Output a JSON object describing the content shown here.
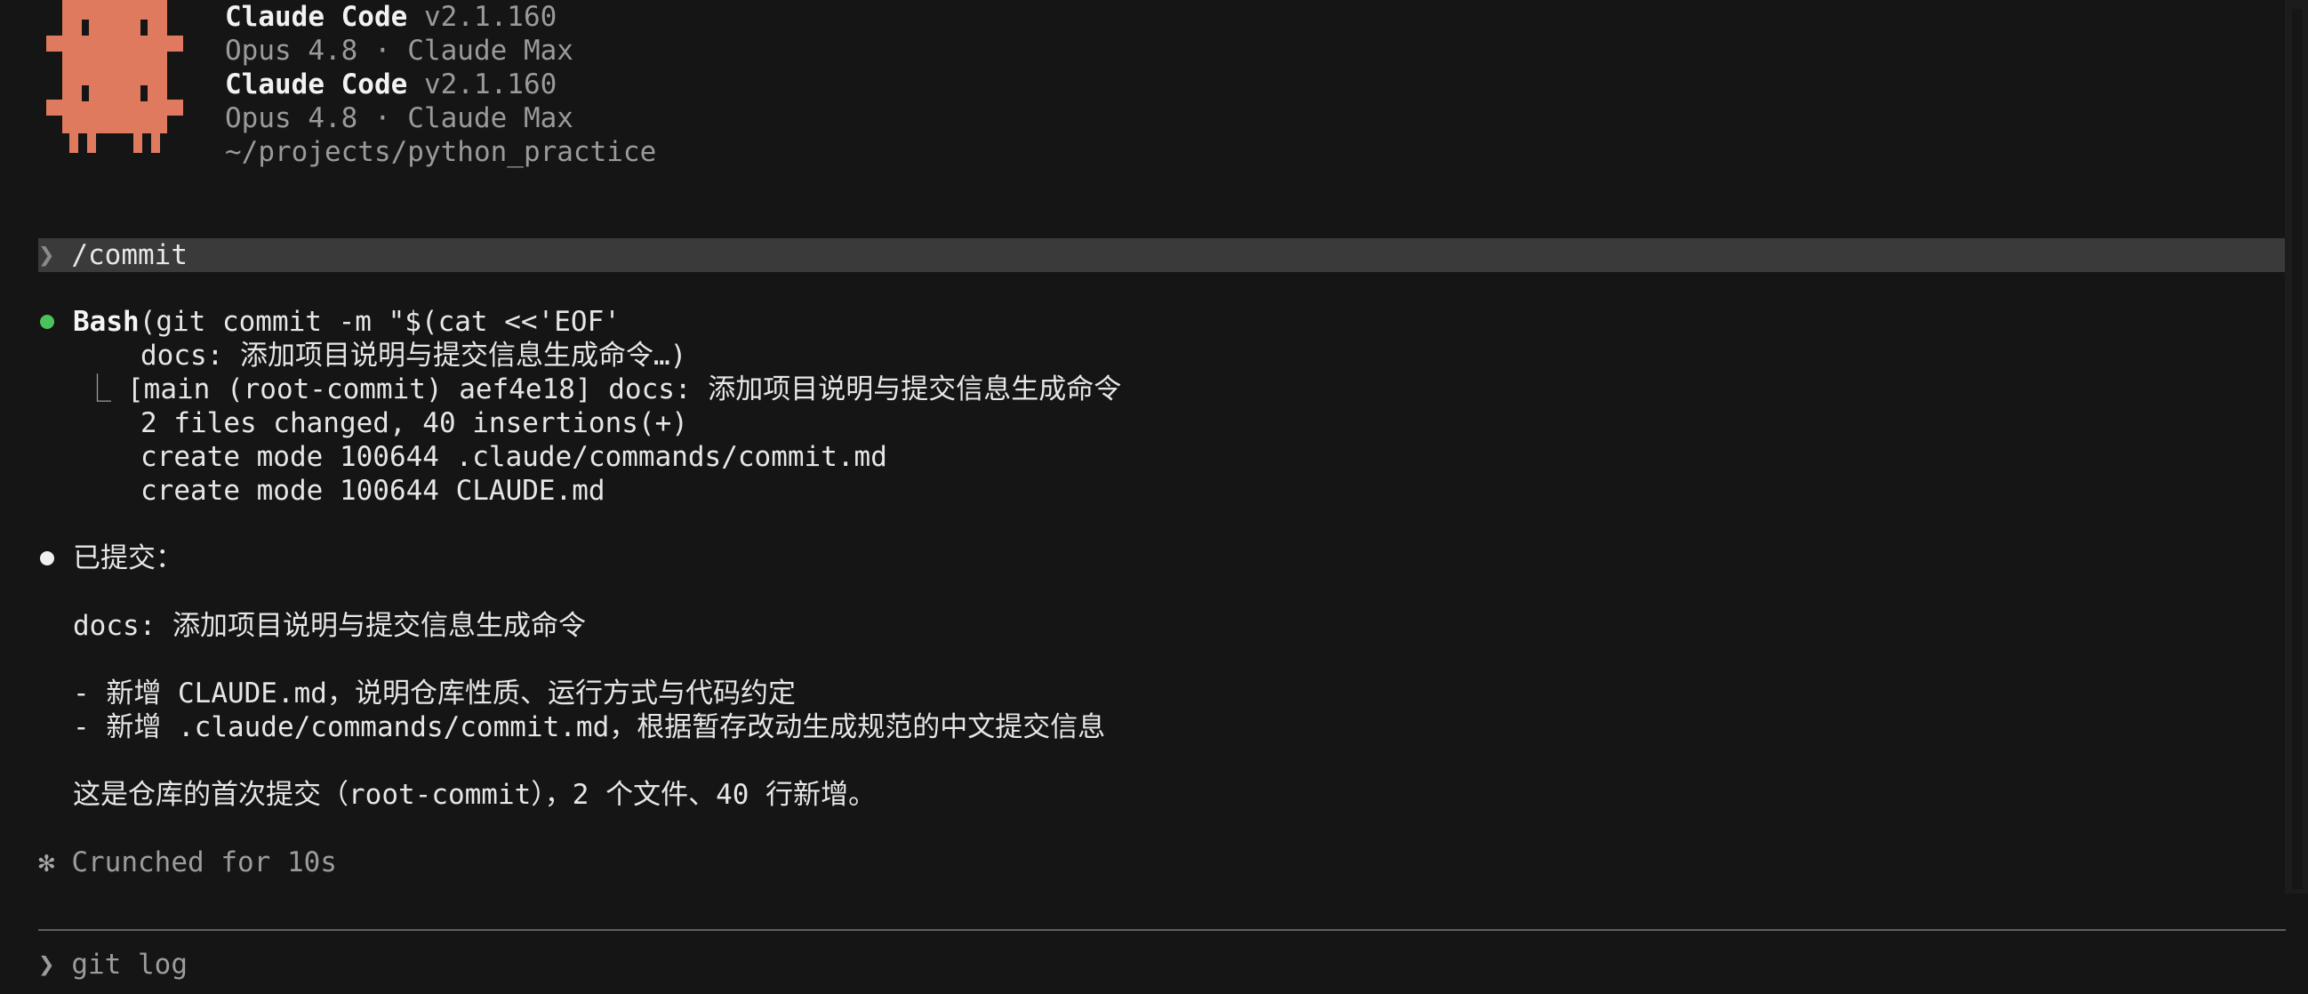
{
  "header": {
    "line1_name": "Claude Code",
    "line1_version": " v2.1.160",
    "line2": "Opus 4.8 · Claude Max",
    "line3_name": "Claude Code",
    "line3_version": " v2.1.160",
    "line4": "Opus 4.8 · Claude Max",
    "cwd": "~/projects/python_practice",
    "mascot_color": "#e07a5f"
  },
  "prompt": {
    "chevron": "❯",
    "command": "/commit"
  },
  "tool_call": {
    "tool_name": "Bash",
    "args_line1": "(git commit -m \"$(cat <<'EOF'",
    "args_line2": "docs: 添加项目说明与提交信息生成命令…)",
    "result_connector": "⎿",
    "result_lines": [
      "[main (root-commit) aef4e18] docs: 添加项目说明与提交信息生成命令",
      "2 files changed, 40 insertions(+)",
      "create mode 100644 .claude/commands/commit.md",
      "create mode 100644 CLAUDE.md"
    ]
  },
  "message": {
    "heading": "已提交：",
    "subject": "docs: 添加项目说明与提交信息生成命令",
    "bullets": [
      "- 新增 CLAUDE.md，说明仓库性质、运行方式与代码约定",
      "- 新增 .claude/commands/commit.md，根据暂存改动生成规范的中文提交信息"
    ],
    "summary": "这是仓库的首次提交（root-commit），2 个文件、40 行新增。"
  },
  "status": {
    "symbol": "✻",
    "text": "Crunched for 10s"
  },
  "input": {
    "chevron": "❯",
    "value": "git log"
  }
}
